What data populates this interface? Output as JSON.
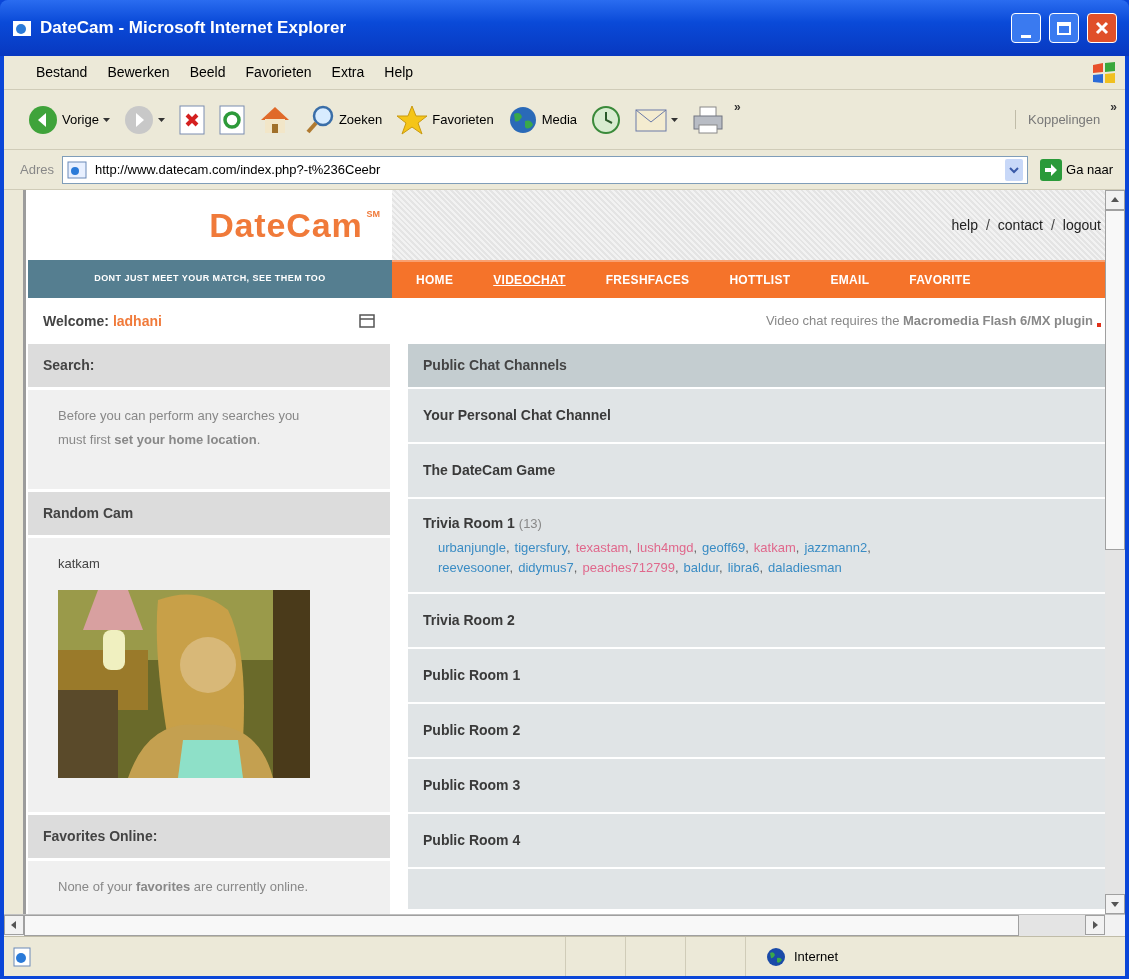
{
  "window": {
    "title": "DateCam - Microsoft Internet Explorer"
  },
  "menu": [
    "Bestand",
    "Bewerken",
    "Beeld",
    "Favorieten",
    "Extra",
    "Help"
  ],
  "toolbar": [
    {
      "kind": "back",
      "label": "Vorige",
      "dropdown": true
    },
    {
      "kind": "forward",
      "dropdown": true
    },
    {
      "kind": "stop",
      "dropdown": false
    },
    {
      "kind": "refresh",
      "dropdown": false
    },
    {
      "kind": "home",
      "dropdown": false
    },
    {
      "kind": "search",
      "label": "Zoeken",
      "dropdown": false
    },
    {
      "kind": "favorites",
      "label": "Favorieten",
      "dropdown": false
    },
    {
      "kind": "media",
      "label": "Media",
      "dropdown": false
    },
    {
      "kind": "history",
      "dropdown": false
    },
    {
      "kind": "mail",
      "dropdown": true
    },
    {
      "kind": "print",
      "dropdown": false
    }
  ],
  "toolbar_overflow": "»",
  "links": {
    "label": "Koppelingen",
    "overflow": "»"
  },
  "address": {
    "label": "Adres",
    "value": "http://www.datecam.com/index.php?-t%236Ceebr",
    "go": "Ga naar"
  },
  "site": {
    "logo": "DateCam",
    "logo_mark": "SM",
    "top_links": [
      "help",
      "contact",
      "logout"
    ],
    "separator": "/",
    "tagline": "DONT JUST MEET YOUR MATCH, SEE THEM TOO",
    "nav": [
      {
        "label": "HOME",
        "selected": false
      },
      {
        "label": "VIDEOCHAT",
        "selected": true
      },
      {
        "label": "FRESHFACES",
        "selected": false
      },
      {
        "label": "HOTTLIST",
        "selected": false
      },
      {
        "label": "EMAIL",
        "selected": false
      },
      {
        "label": "FAVORITE",
        "selected": false
      }
    ]
  },
  "welcome": {
    "label": "Welcome:",
    "user": "ladhani"
  },
  "notice": "Video chat requires the **Macromedia Flash 6/MX plugin**",
  "sidebar": [
    {
      "kind": "text",
      "title": "Search:",
      "text": "Before you can perform any searches you must first **set your home location**."
    },
    {
      "kind": "cam",
      "title": "Random Cam",
      "user": "katkam"
    },
    {
      "kind": "text",
      "title": "Favorites Online:",
      "text": "None of your **favorites** are currently online."
    }
  ],
  "channels": {
    "title": "Public Chat Channels",
    "rooms": [
      {
        "name": "Your Personal Chat Channel"
      },
      {
        "name": "The DateCam Game"
      },
      {
        "name": "Trivia Room 1",
        "count": "(13)",
        "separator": ",",
        "users": [
          {
            "name": "urbanjungle",
            "color": "#3a8cc4"
          },
          {
            "name": "tigersfury",
            "color": "#3a8cc4"
          },
          {
            "name": "texastam",
            "color": "#e0688c"
          },
          {
            "name": "lush4mgd",
            "color": "#e0688c"
          },
          {
            "name": "geoff69",
            "color": "#3a8cc4"
          },
          {
            "name": "katkam",
            "color": "#e0688c"
          },
          {
            "name": "jazzmann2",
            "color": "#3a8cc4"
          },
          {
            "name": "reevesooner",
            "color": "#3a8cc4"
          },
          {
            "name": "didymus7",
            "color": "#3a8cc4"
          },
          {
            "name": "peaches712799",
            "color": "#e0688c"
          },
          {
            "name": "baldur",
            "color": "#3a8cc4"
          },
          {
            "name": "libra6",
            "color": "#3a8cc4"
          },
          {
            "name": "daladiesman",
            "color": "#3a8cc4"
          }
        ]
      },
      {
        "name": "Trivia Room 2"
      },
      {
        "name": "Public Room 1"
      },
      {
        "name": "Public Room 2"
      },
      {
        "name": "Public Room 3"
      },
      {
        "name": "Public Room 4"
      }
    ]
  },
  "status": {
    "zone": "Internet"
  }
}
